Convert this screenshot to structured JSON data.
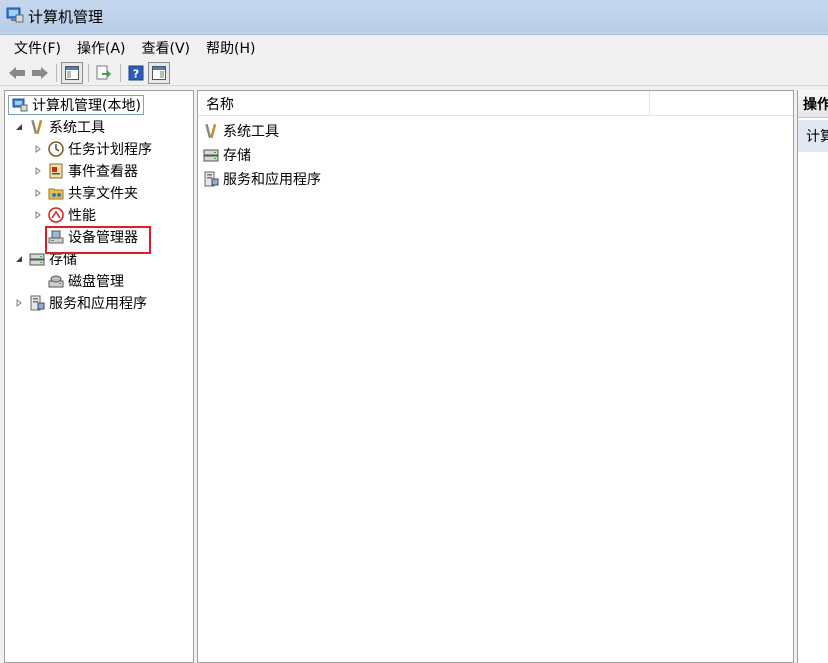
{
  "window": {
    "title": "计算机管理"
  },
  "menu": [
    "文件(F)",
    "操作(A)",
    "查看(V)",
    "帮助(H)"
  ],
  "tree": {
    "root": "计算机管理(本地)",
    "system_tools": "系统工具",
    "task_scheduler": "任务计划程序",
    "event_viewer": "事件查看器",
    "shared_folders": "共享文件夹",
    "performance": "性能",
    "device_manager": "设备管理器",
    "storage": "存储",
    "disk_management": "磁盘管理",
    "services_apps": "服务和应用程序"
  },
  "list": {
    "column_name": "名称",
    "items": [
      "系统工具",
      "存储",
      "服务和应用程序"
    ]
  },
  "actions": {
    "header": "操作",
    "item": "计算"
  },
  "colors": {
    "highlight": "#e01c24",
    "accent": "#2f6fbf"
  }
}
